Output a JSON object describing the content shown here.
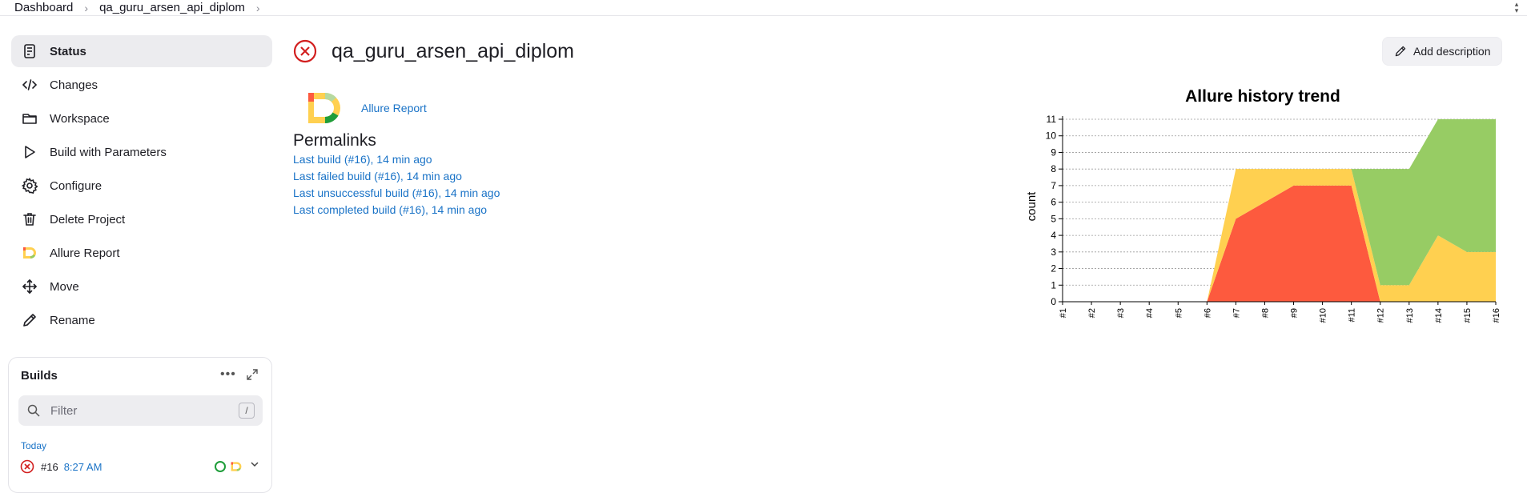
{
  "breadcrumb": {
    "items": [
      "Dashboard",
      "qa_guru_arsen_api_diplom"
    ]
  },
  "sidebar": {
    "items": [
      {
        "label": "Status",
        "icon": "status-icon",
        "active": true
      },
      {
        "label": "Changes",
        "icon": "code-icon"
      },
      {
        "label": "Workspace",
        "icon": "folder-icon"
      },
      {
        "label": "Build with Parameters",
        "icon": "play-icon"
      },
      {
        "label": "Configure",
        "icon": "gear-icon"
      },
      {
        "label": "Delete Project",
        "icon": "trash-icon"
      },
      {
        "label": "Allure Report",
        "icon": "allure-icon"
      },
      {
        "label": "Move",
        "icon": "move-icon"
      },
      {
        "label": "Rename",
        "icon": "pencil-icon"
      }
    ]
  },
  "builds": {
    "title": "Builds",
    "filter_placeholder": "Filter",
    "filter_key": "/",
    "group": "Today",
    "rows": [
      {
        "number": "#16",
        "time": "8:27 AM",
        "status": "failed"
      }
    ]
  },
  "main": {
    "title": "qa_guru_arsen_api_diplom",
    "status": "failed",
    "add_description": "Add description",
    "allure_link": "Allure Report",
    "permalinks_title": "Permalinks",
    "permalinks": [
      "Last build (#16), 14 min ago",
      "Last failed build (#16), 14 min ago",
      "Last unsuccessful build (#16), 14 min ago",
      "Last completed build (#16), 14 min ago"
    ]
  },
  "colors": {
    "failed": "#fd5a3e",
    "broken": "#ffd050",
    "passed": "#97cc64",
    "link": "#1a73c7",
    "error_red": "#d21f1f"
  },
  "chart_data": {
    "type": "area",
    "title": "Allure history trend",
    "ylabel": "count",
    "xlabel": "",
    "ylim": [
      0,
      11
    ],
    "yticks": [
      0,
      1,
      2,
      3,
      4,
      5,
      6,
      7,
      8,
      9,
      10,
      11
    ],
    "x": [
      "#1",
      "#2",
      "#3",
      "#4",
      "#5",
      "#6",
      "#7",
      "#8",
      "#9",
      "#10",
      "#11",
      "#12",
      "#13",
      "#14",
      "#15",
      "#16"
    ],
    "stacked": true,
    "grid": true,
    "series": [
      {
        "color": "#fd5a3e",
        "values": [
          0,
          0,
          0,
          0,
          0,
          0,
          5,
          6,
          7,
          7,
          7,
          0,
          0,
          0,
          0,
          0
        ]
      },
      {
        "color": "#ffd050",
        "values": [
          0,
          0,
          0,
          0,
          0,
          0,
          3,
          2,
          1,
          1,
          1,
          1,
          1,
          4,
          3,
          3
        ]
      },
      {
        "color": "#97cc64",
        "values": [
          0,
          0,
          0,
          0,
          0,
          0,
          0,
          0,
          0,
          0,
          0,
          7,
          7,
          7,
          8,
          8
        ]
      }
    ]
  }
}
